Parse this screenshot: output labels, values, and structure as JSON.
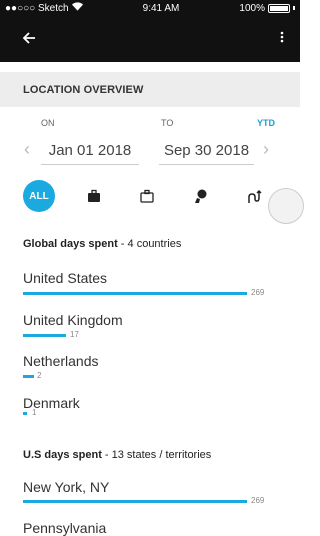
{
  "status": {
    "carrier": "●●○○○ Sketch",
    "time": "9:41 AM",
    "battery": "100%"
  },
  "nav": {
    "back_icon": "arrow-left-icon",
    "menu_icon": "more-vertical-icon"
  },
  "section_title": "LOCATION OVERVIEW",
  "range": {
    "on_label": "ON",
    "to_label": "TO",
    "ytd_label": "YTD",
    "start": "Jan 01 2018",
    "end": "Sep 30 2018"
  },
  "filters": {
    "all_label": "ALL",
    "icons": [
      "briefcase-icon",
      "bag-icon",
      "person-globe-icon",
      "route-icon"
    ],
    "accent": "#1aaae0"
  },
  "global": {
    "title": "Global days spent",
    "suffix": " - 4 countries",
    "max": 269,
    "rows": [
      {
        "name": "United States",
        "days": 269
      },
      {
        "name": "United Kingdom",
        "days": 17
      },
      {
        "name": "Netherlands",
        "days": 2
      },
      {
        "name": "Denmark",
        "days": 1
      }
    ]
  },
  "us": {
    "title": "U.S days spent",
    "suffix": " - 13 states / territories",
    "max": 269,
    "rows": [
      {
        "name": "New York, NY",
        "days": 269
      },
      {
        "name": "Pennsylvania",
        "days": null
      }
    ]
  }
}
